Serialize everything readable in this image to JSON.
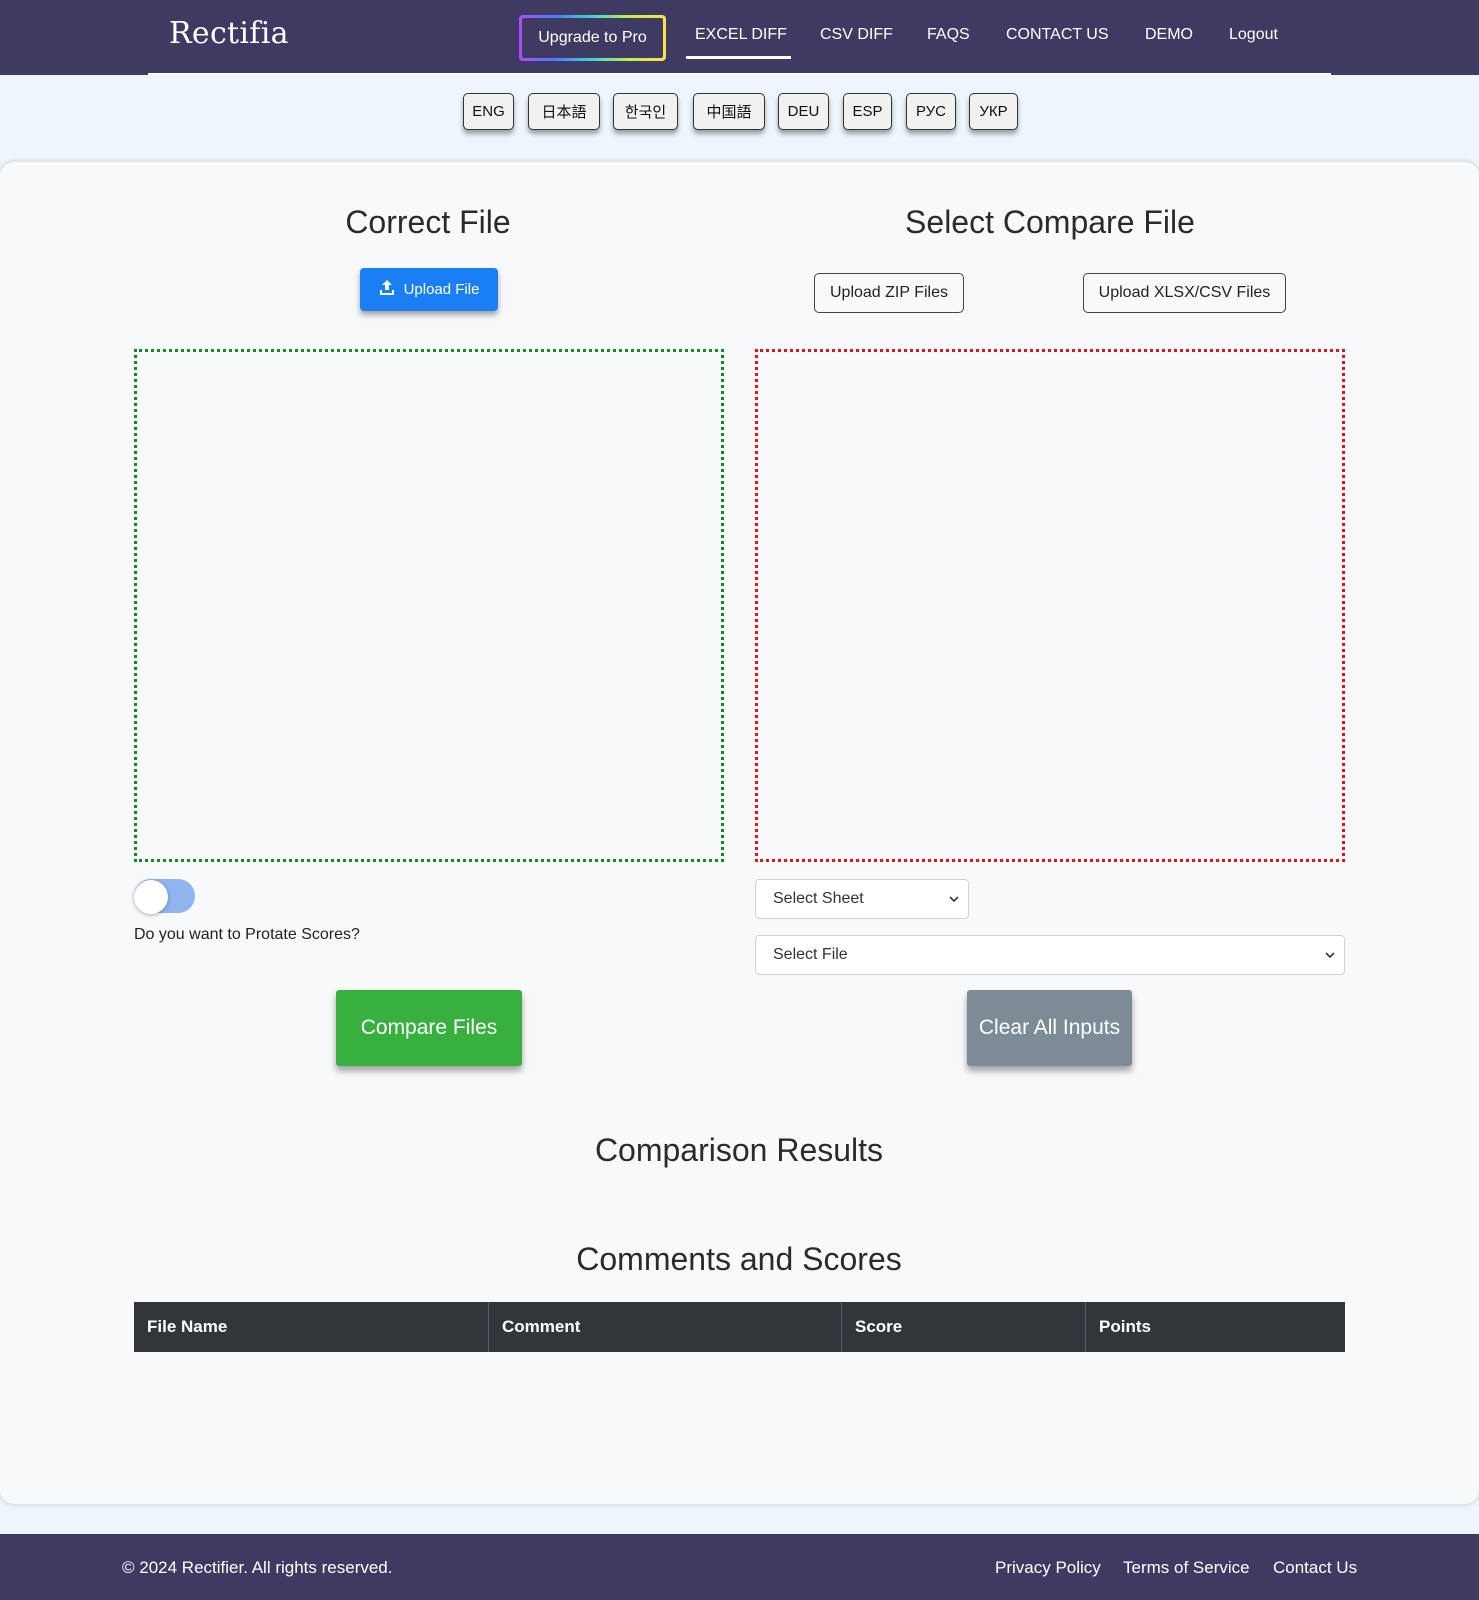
{
  "header": {
    "logo": "Rectifia",
    "upgrade_label": "Upgrade to Pro",
    "nav": [
      {
        "label": "EXCEL DIFF",
        "active": true
      },
      {
        "label": "CSV DIFF"
      },
      {
        "label": "FAQS"
      },
      {
        "label": "CONTACT US"
      },
      {
        "label": "DEMO"
      },
      {
        "label": "Logout"
      }
    ]
  },
  "languages": [
    "ENG",
    "日本語",
    "한국인",
    "中国語",
    "DEU",
    "ESP",
    "РУС",
    "УКР"
  ],
  "correct": {
    "title": "Correct File",
    "upload_label": "Upload File",
    "upload_icon": "upload-icon"
  },
  "compare": {
    "title": "Select Compare File",
    "zip_label": "Upload ZIP Files",
    "xlsx_label": "Upload XLSX/CSV Files"
  },
  "toggle": {
    "label": "Do you want to Protate Scores?",
    "on": false
  },
  "selects": {
    "sheet": "Select Sheet",
    "file": "Select File"
  },
  "actions": {
    "compare": "Compare Files",
    "clear": "Clear All Inputs"
  },
  "results": {
    "title": "Comparison Results"
  },
  "scores": {
    "title": "Comments and Scores",
    "columns": [
      "File Name",
      "Comment",
      "Score",
      "Points"
    ]
  },
  "footer": {
    "copyright": "© 2024 Rectifier. All rights reserved.",
    "links": [
      "Privacy Policy",
      "Terms of Service",
      "Contact Us"
    ]
  },
  "colors": {
    "header_bg": "#3f3a62",
    "upload_blue": "#1a7ff5",
    "compare_green": "#38b03f",
    "clear_gray": "#7d8b96",
    "dropzone_green": "#138a1e",
    "dropzone_red": "#e0141f",
    "table_header": "#32363b"
  }
}
